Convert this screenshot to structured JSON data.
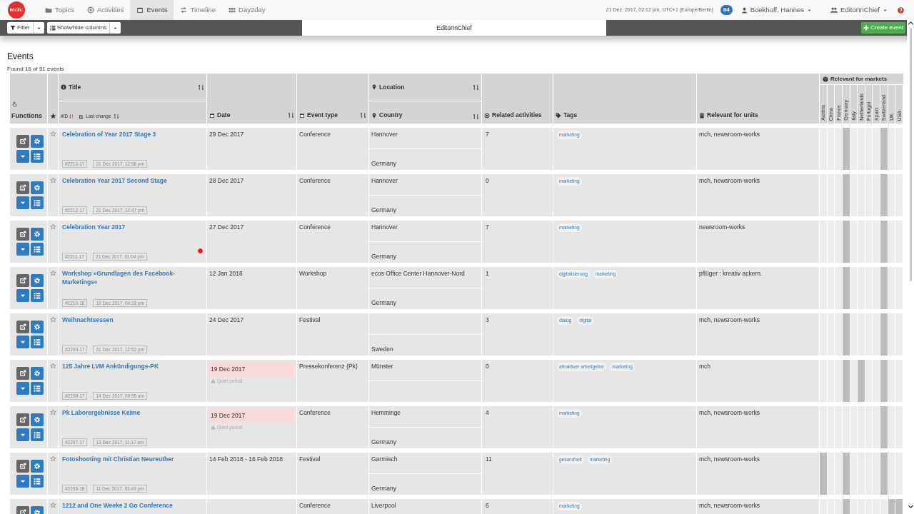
{
  "nav": {
    "logo": "mch:",
    "tabs": [
      {
        "label": "Topics",
        "selected": false
      },
      {
        "label": "Activities",
        "selected": false
      },
      {
        "label": "Events",
        "selected": true
      },
      {
        "label": "Timeline",
        "selected": false
      },
      {
        "label": "Day2day",
        "selected": false
      }
    ],
    "datetime": "21 Dez. 2017, 02:12 pm, UTC+1 (Europe/Berlin)",
    "notifications": "84",
    "user": "Boekhoff, Hannes",
    "role": "EditorInChief"
  },
  "toolbar": {
    "filter": "Filter",
    "columns": "Show/hide columns",
    "role_box": "EditorInChief",
    "create": "Create event"
  },
  "page": {
    "title": "Events",
    "found": "Found 16 of 51 events"
  },
  "columns": {
    "functions": "Functions",
    "title": "Title",
    "id": "#ID",
    "last_change": "Last change",
    "date": "Date",
    "event_type": "Event type",
    "location": "Location",
    "country": "Country",
    "related": "Related activities",
    "tags": "Tags",
    "units": "Relevant for units",
    "markets_title": "Relevant for markets",
    "markets": [
      "Austria",
      "China",
      "France",
      "Germany",
      "Italy",
      "Netherlands",
      "Portugal",
      "Spain",
      "Switzerland",
      "UK",
      "USA"
    ]
  },
  "rows": [
    {
      "title": "Celebration of Year 2017 Stage 3",
      "id": "#2213-17",
      "changed": "21 Dec 2017, 12:58 pm",
      "date": "29 Dec 2017",
      "type": "Conference",
      "city": "Hannover",
      "country": "Germany",
      "related": "7",
      "tags": [
        "marketing"
      ],
      "units": "mch, newsroom-works",
      "alert": false,
      "markets": [
        false,
        false,
        false,
        true,
        false,
        false,
        false,
        false,
        true,
        false,
        false
      ]
    },
    {
      "title": "Celebration Year 2017 Second Stage",
      "id": "#2212-17",
      "changed": "21 Dec 2017, 12:47 pm",
      "date": "28 Dec 2017",
      "type": "Conference",
      "city": "Hannover",
      "country": "Germany",
      "related": "0",
      "tags": [
        "marketing"
      ],
      "units": "mch, newsroom-works",
      "alert": false,
      "markets": [
        false,
        false,
        false,
        true,
        false,
        false,
        false,
        false,
        true,
        false,
        false
      ]
    },
    {
      "title": "Celebration Year 2017",
      "id": "#2211-17",
      "changed": "21 Dec 2017, 01:04 pm",
      "date": "27 Dec 2017",
      "type": "Conference",
      "city": "Hannover",
      "country": "Germany",
      "related": "7",
      "tags": [
        "marketing"
      ],
      "units": "newsroom-works",
      "alert": true,
      "markets": [
        false,
        false,
        false,
        true,
        false,
        false,
        false,
        false,
        true,
        false,
        false
      ]
    },
    {
      "title": "Workshop »Grundlagen des Facebook-Marketings«",
      "id": "#2210-18",
      "changed": "19 Dec 2017, 04:18 pm",
      "date": "12 Jan 2018",
      "type": "Workshop",
      "city": "ecos Office Center Hannover-Nord",
      "country": "Germany",
      "related": "1",
      "tags": [
        "digitalisierung",
        "marketing"
      ],
      "units": "pflüger : kreativ ackern.",
      "alert": false,
      "markets": [
        false,
        false,
        false,
        true,
        false,
        false,
        false,
        false,
        true,
        false,
        false
      ]
    },
    {
      "title": "Weihnachtsessen",
      "id": "#2209-17",
      "changed": "21 Dec 2017, 12:52 pm",
      "date": "24 Dec 2017",
      "type": "Festival",
      "country": "Sweden",
      "related": "3",
      "tags": [
        "dialog",
        "digital"
      ],
      "units": "mch, newsroom-works",
      "alert": false,
      "markets": [
        false,
        false,
        false,
        true,
        false,
        false,
        false,
        false,
        true,
        false,
        false
      ]
    },
    {
      "title": "125 Jahre LVM Ankündigungs-PK",
      "id": "#2208-17",
      "changed": "14 Dec 2017, 09:55 am",
      "date": "19 Dec 2017",
      "date_note": "Quiet period",
      "type": "Pressekonferenz (Pk)",
      "city": "Münster",
      "related": "0",
      "tags": [
        "attraktiver arbeitgeber",
        "marketing"
      ],
      "units": "mch",
      "alert": false,
      "markets": [
        false,
        false,
        false,
        true,
        false,
        true,
        false,
        false,
        true,
        false,
        false
      ]
    },
    {
      "title": "Pk Laborergebnisse Keime",
      "id": "#2207-17",
      "changed": "13 Dec 2017, 11:17 am",
      "date": "19 Dec 2017",
      "date_note": "Quiet period",
      "type": "Conference",
      "city": "Hemminge",
      "country": "Germany",
      "related": "4",
      "tags": [
        "marketing"
      ],
      "units": "mch, newsroom-works",
      "alert": false,
      "markets": [
        false,
        false,
        false,
        false,
        false,
        false,
        false,
        false,
        true,
        false,
        false
      ]
    },
    {
      "title": "Fotoshooting mit Christian Neureuther",
      "id": "#2206-18",
      "changed": "11 Dec 2017, 03:49 pm",
      "date": "14 Feb 2018 - 16 Feb 2018",
      "type": "Festival",
      "city": "Garmisch",
      "country": "Germany",
      "related": "11",
      "tags": [
        "gesundheit",
        "marketing"
      ],
      "units": "mch, newsroom-works",
      "alert": false,
      "markets": [
        true,
        false,
        false,
        true,
        false,
        false,
        false,
        false,
        true,
        false,
        false
      ]
    },
    {
      "title": "1212 and One Weeke 2 Go Conference",
      "type": "Conference",
      "city": "Liverpool",
      "related": "6",
      "tags": [
        "marketing"
      ],
      "units": "mch, newsroom-works",
      "alert": false,
      "markets": [
        false,
        false,
        false,
        true,
        false,
        false,
        false,
        false,
        false,
        true,
        true
      ]
    }
  ]
}
